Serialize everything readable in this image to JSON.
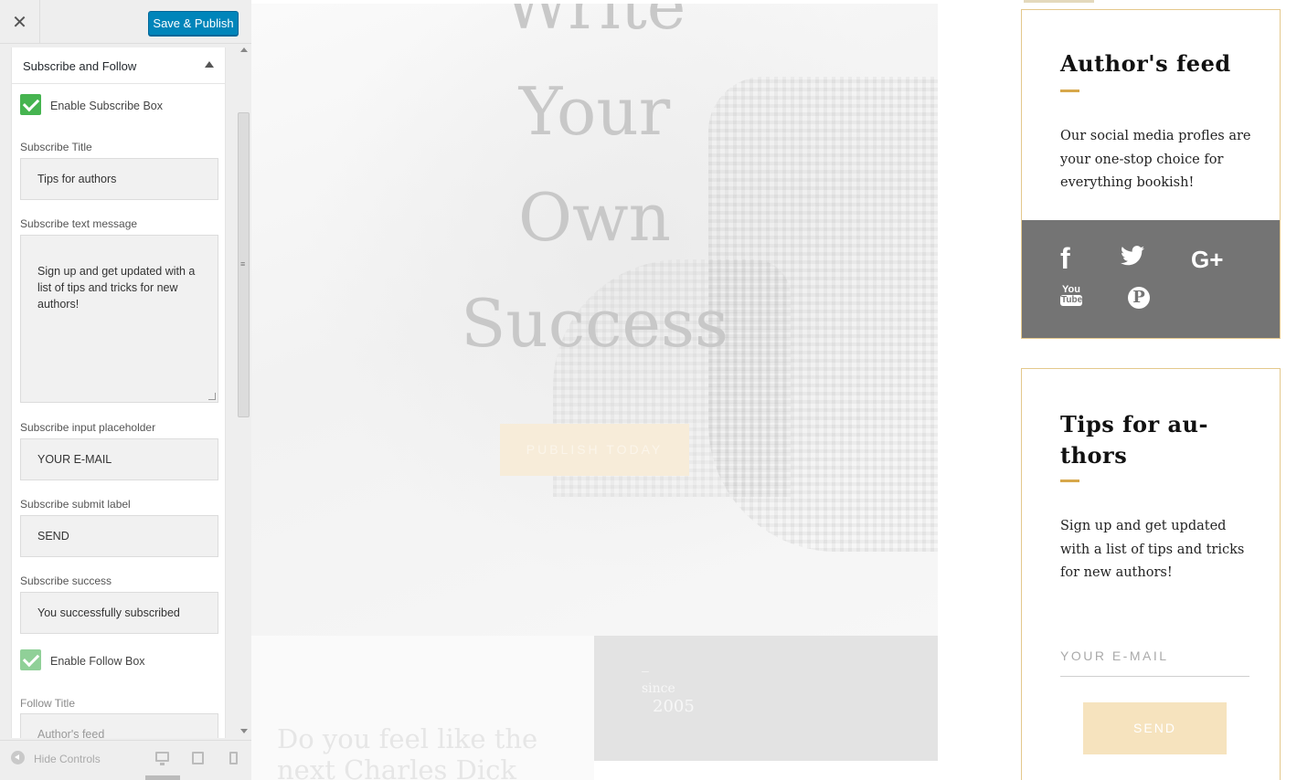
{
  "customizer": {
    "close_label": "✕",
    "save_label": "Save & Publish",
    "section": {
      "title": "Subscribe and Follow",
      "enable_subscribe_label": "Enable Subscribe Box",
      "enable_subscribe_checked": true,
      "subscribe_title_label": "Subscribe Title",
      "subscribe_title_value": "Tips for authors",
      "subscribe_text_label": "Subscribe text message",
      "subscribe_text_value": "Sign up and get updated with a\nlist of tips and tricks for new\nauthors!",
      "placeholder_label": "Subscribe input placeholder",
      "placeholder_value": "YOUR E-MAIL",
      "submit_label_label": "Subscribe submit label",
      "submit_label_value": "SEND",
      "success_label": "Subscribe success",
      "success_value": "You successfully subscribed",
      "enable_follow_label": "Enable Follow Box",
      "enable_follow_checked": true,
      "follow_title_label": "Follow Title",
      "follow_title_value": "Author's feed"
    },
    "footer": {
      "hide_controls_label": "Hide Controls",
      "scroll_grip": "≡"
    }
  },
  "preview": {
    "hero": {
      "lines": [
        "Write",
        "Your",
        "Own",
        "Success"
      ],
      "cta_label": "PUBLISH TODAY"
    },
    "feel_text": "Do you feel like the next Charles Dick",
    "since": {
      "dash": "–",
      "label": "since",
      "year": "2005"
    },
    "feed_widget": {
      "title": "Author's feed",
      "text": "Our social media profles are your one-stop choice for everything bookish!",
      "icons": [
        "facebook-icon",
        "twitter-icon",
        "google-plus-icon",
        "youtube-icon",
        "pinterest-icon"
      ],
      "fb_glyph": "f",
      "gp_glyph": "G+",
      "yt_you": "You",
      "yt_tube": "Tube",
      "pin_glyph": "P"
    },
    "tips_widget": {
      "title": "Tips for au-\nthors",
      "text": "Sign up and get updated with a list of tips and tricks for new authors!",
      "email_placeholder": "YOUR E-MAIL",
      "send_label": "SEND"
    }
  },
  "colors": {
    "primary_button": "#0085ba",
    "checkbox_green": "#46b450",
    "widget_border": "#e4c88c",
    "accent_gold": "#d7a84b",
    "social_bg": "#747474",
    "send_button": "#f6e3be"
  }
}
